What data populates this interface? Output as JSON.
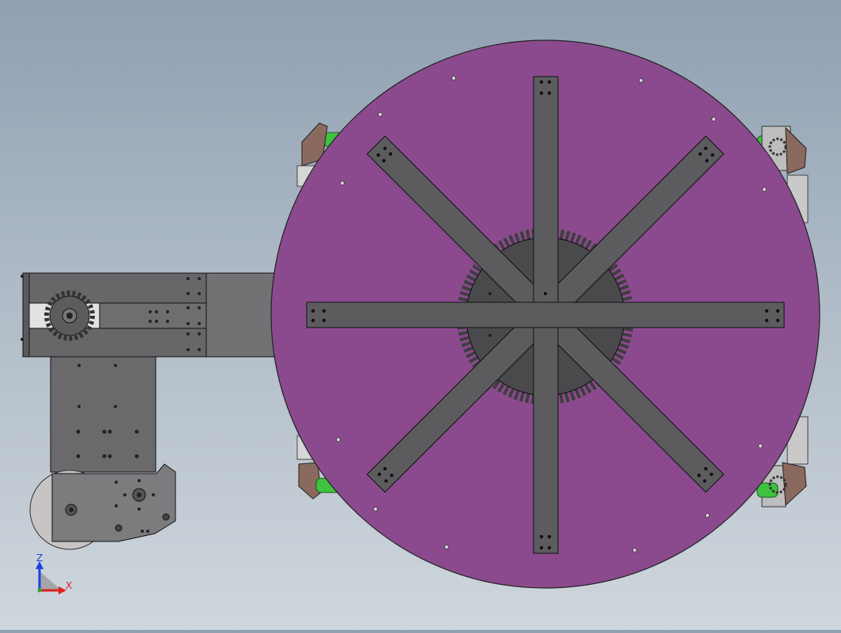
{
  "view": {
    "type": "cad-model-viewport",
    "projection": "front",
    "triad": {
      "vertical_axis": "Z",
      "horizontal_axis": "X"
    }
  },
  "colors": {
    "background_top": "#8fa0b2",
    "background_bottom": "#cfd6dd",
    "turntable_disc": "#8b4a8e",
    "arm_steel": "#5c5c5e",
    "bracket_steel": "#757577",
    "gear": "#4a4a4c",
    "pad": "#8a6a5e",
    "roller_green": "#3fc23f",
    "triad_z": "#1f3fe0",
    "triad_x": "#e01f1f"
  }
}
